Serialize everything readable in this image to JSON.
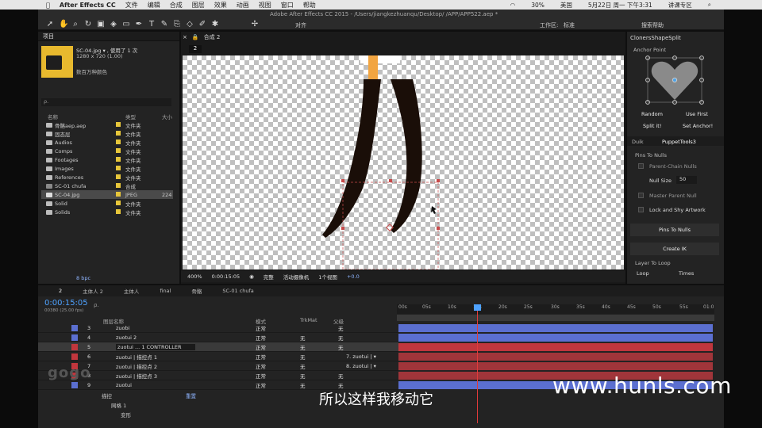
{
  "menubar": {
    "app_name": "After Effects CC",
    "items": [
      "文件",
      "编辑",
      "合成",
      "图层",
      "效果",
      "动画",
      "视图",
      "窗口",
      "帮助"
    ],
    "battery": "30%",
    "locale": "美国",
    "datetime": "5月22日 周一 下午3:31",
    "user": "讲课专区",
    "search_label": "搜索帮助"
  },
  "toolbar": {
    "title": "Adobe After Effects CC 2015 - /Users/jiangkezhuanqu/Desktop/ /APP/APP522.aep *",
    "align_label": "对齐",
    "workspace_label": "工作区:",
    "workspace_value": "标准"
  },
  "project": {
    "tab_label": "项目",
    "file_name": "SC-04.jpg ▾ , 使用了 1 次",
    "file_dims": "1280 x 720 (1.00)",
    "file_color": "数百万种颜色",
    "search_placeholder": "ρ.",
    "col_name": "名称",
    "col_type": "类型",
    "col_size": "大小",
    "items": [
      {
        "name": "骨骼aep.aep",
        "type": "文件夹",
        "size": ""
      },
      {
        "name": "固态层",
        "type": "文件夹",
        "size": ""
      },
      {
        "name": "Audios",
        "type": "文件夹",
        "size": ""
      },
      {
        "name": "Comps",
        "type": "文件夹",
        "size": ""
      },
      {
        "name": "Footages",
        "type": "文件夹",
        "size": ""
      },
      {
        "name": "Images",
        "type": "文件夹",
        "size": ""
      },
      {
        "name": "References",
        "type": "文件夹",
        "size": ""
      },
      {
        "name": "SC-01 chufa",
        "type": "合成",
        "size": ""
      },
      {
        "name": "SC-04.jpg",
        "type": "JPEG",
        "size": "224"
      },
      {
        "name": "Solid",
        "type": "文件夹",
        "size": ""
      },
      {
        "name": "Solids",
        "type": "文件夹",
        "size": ""
      }
    ],
    "bpc": "8 bpc"
  },
  "composition": {
    "tab_label": "合成 2",
    "comp_badge": "2",
    "zoom": "400%",
    "timecode": "0:00:15:05",
    "resolution": "完整",
    "camera": "活动摄像机",
    "views": "1个视图",
    "exposure": "+0.0"
  },
  "clonerspanel": {
    "title": "ClonersShapeSplit",
    "anchor_label": "Anchor Point",
    "random_label": "Random",
    "use_first_label": "Use First",
    "split_label": "Split it!",
    "set_anchor_label": "Set Anchor!"
  },
  "puppetpanel": {
    "tab_duik": "Duik",
    "tab_puppet": "PuppetTools3",
    "pins_to_nulls_hdr": "Pins To Nulls",
    "parent_chain": "Parent-Chain Nulls",
    "null_size_label": "Null Size",
    "null_size_value": "50",
    "master_parent": "Master Parent Null",
    "lock_shy": "Lock and Shy Artwork",
    "pins_btn": "Pins To Nulls",
    "create_ik_btn": "Create IK",
    "layer_to_loop": "Layer To Loop",
    "loop_label": "Loop",
    "times_label": "Times"
  },
  "timeline": {
    "tabs": [
      "2",
      "主体人 2",
      "主体人",
      "final",
      "骨骼",
      "SC-01 chufa"
    ],
    "timecode": "0:00:15:05",
    "frames": "00380 (25.00 fps)",
    "col_layername": "图层名称",
    "col_mode": "模式",
    "col_trkmat": "TrkMat",
    "col_parent": "父级",
    "ruler_ticks": [
      "00s",
      "05s",
      "10s",
      "15s",
      "20s",
      "25s",
      "30s",
      "35s",
      "40s",
      "45s",
      "50s",
      "55s",
      "01:0"
    ],
    "layers": [
      {
        "num": "3",
        "name": "zuobi",
        "mode": "正常",
        "trk": "",
        "parent": "无",
        "color": "#5b6fd0"
      },
      {
        "num": "4",
        "name": "zuotui 2",
        "mode": "正常",
        "trk": "无",
        "parent": "无",
        "color": "#5b6fd0"
      },
      {
        "num": "5",
        "name": "zuotui ... 1 CONTROLLER",
        "mode": "正常",
        "trk": "无",
        "parent": "无",
        "color": "#c0363d"
      },
      {
        "num": "6",
        "name": "zuotui | 描控点 1",
        "mode": "正常",
        "trk": "无",
        "parent": "7. zuotui | ▾",
        "color": "#c0363d"
      },
      {
        "num": "7",
        "name": "zuotui | 描控点 2",
        "mode": "正常",
        "trk": "无",
        "parent": "8. zuotui | ▾",
        "color": "#c0363d"
      },
      {
        "num": "8",
        "name": "zuotui | 描控点 3",
        "mode": "正常",
        "trk": "无",
        "parent": "无",
        "color": "#c0363d"
      },
      {
        "num": "9",
        "name": "zuotui",
        "mode": "正常",
        "trk": "无",
        "parent": "无",
        "color": "#5b6fd0"
      }
    ],
    "sub_effects": "描控",
    "sub_reset": "重置",
    "sub_mesh": "网格 1",
    "sub_deform": "变形"
  },
  "overlay": {
    "subtitle": "所以这样我移动它",
    "watermark": "www.hunls.com",
    "ghost": "gogo"
  }
}
